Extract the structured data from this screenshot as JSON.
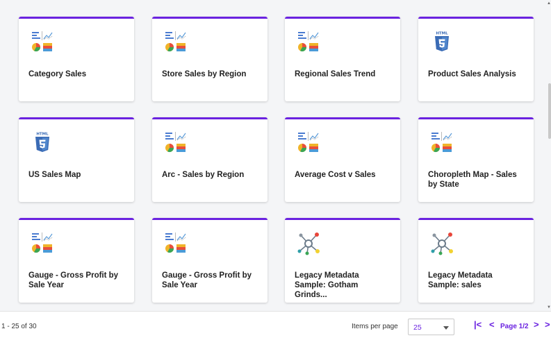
{
  "cards": [
    {
      "title": "Category Sales",
      "icon": "chart-icon"
    },
    {
      "title": "Store Sales by Region",
      "icon": "chart-icon"
    },
    {
      "title": "Regional Sales Trend",
      "icon": "chart-icon"
    },
    {
      "title": "Product Sales Analysis",
      "icon": "html5-icon"
    },
    {
      "title": "US Sales Map",
      "icon": "html5-icon"
    },
    {
      "title": "Arc - Sales by Region",
      "icon": "chart-icon"
    },
    {
      "title": "Average Cost v Sales",
      "icon": "chart-icon"
    },
    {
      "title": "Choropleth Map - Sales by State",
      "icon": "chart-icon"
    },
    {
      "title": "Gauge - Gross Profit by Sale Year",
      "icon": "chart-icon"
    },
    {
      "title": "Gauge - Gross Profit by Sale Year",
      "icon": "chart-icon"
    },
    {
      "title": "Legacy Metadata Sample: Gotham Grinds...",
      "icon": "metadata-icon"
    },
    {
      "title": "Legacy Metadata Sample: sales",
      "icon": "metadata-icon"
    }
  ],
  "footer": {
    "range": "1 - 25 of 30",
    "items_per_page_label": "Items per page",
    "items_per_page_value": "25",
    "page_label": "Page 1/2",
    "first_symbol": "|<",
    "prev_symbol": "<",
    "next_symbol": ">",
    "last_symbol": ">"
  },
  "colors": {
    "accent": "#6a22e0",
    "background": "#f4f5f7"
  }
}
